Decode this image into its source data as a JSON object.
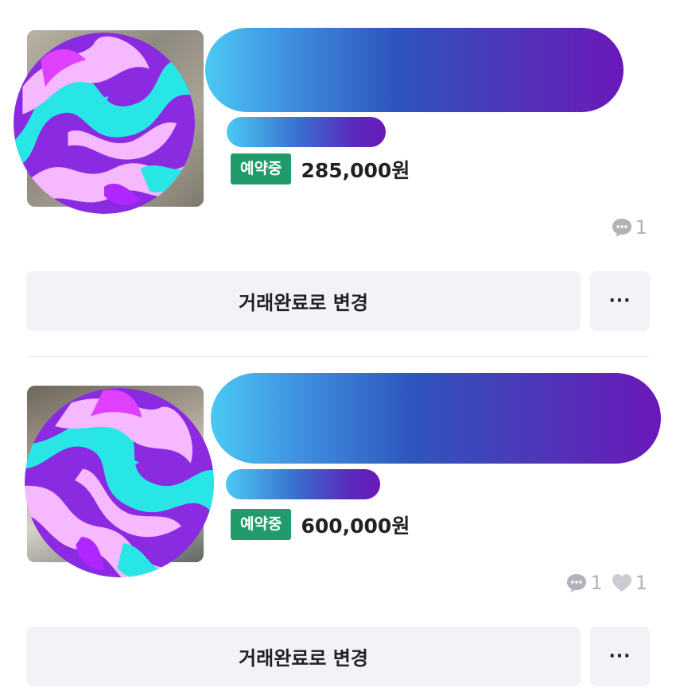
{
  "items": [
    {
      "status_badge": "예약중",
      "price": "285,000원",
      "comment_count": "1",
      "action_label": "거래완료로 변경",
      "more_label": "···",
      "thumbnail_icon": "photo-icon",
      "avatar_icon": "marble-sphere-icon"
    },
    {
      "status_badge": "예약중",
      "price": "600,000원",
      "comment_count": "1",
      "like_count": "1",
      "action_label": "거래완료로 변경",
      "more_label": "···",
      "thumbnail_icon": "photo-icon",
      "avatar_icon": "marble-sphere-icon"
    }
  ],
  "colors": {
    "badge_green": "#219b6c",
    "button_bg": "#f2f3f6",
    "meta_gray": "#b0b3b8",
    "gradient_start": "#4ac9f3",
    "gradient_end": "#6b18b9"
  }
}
